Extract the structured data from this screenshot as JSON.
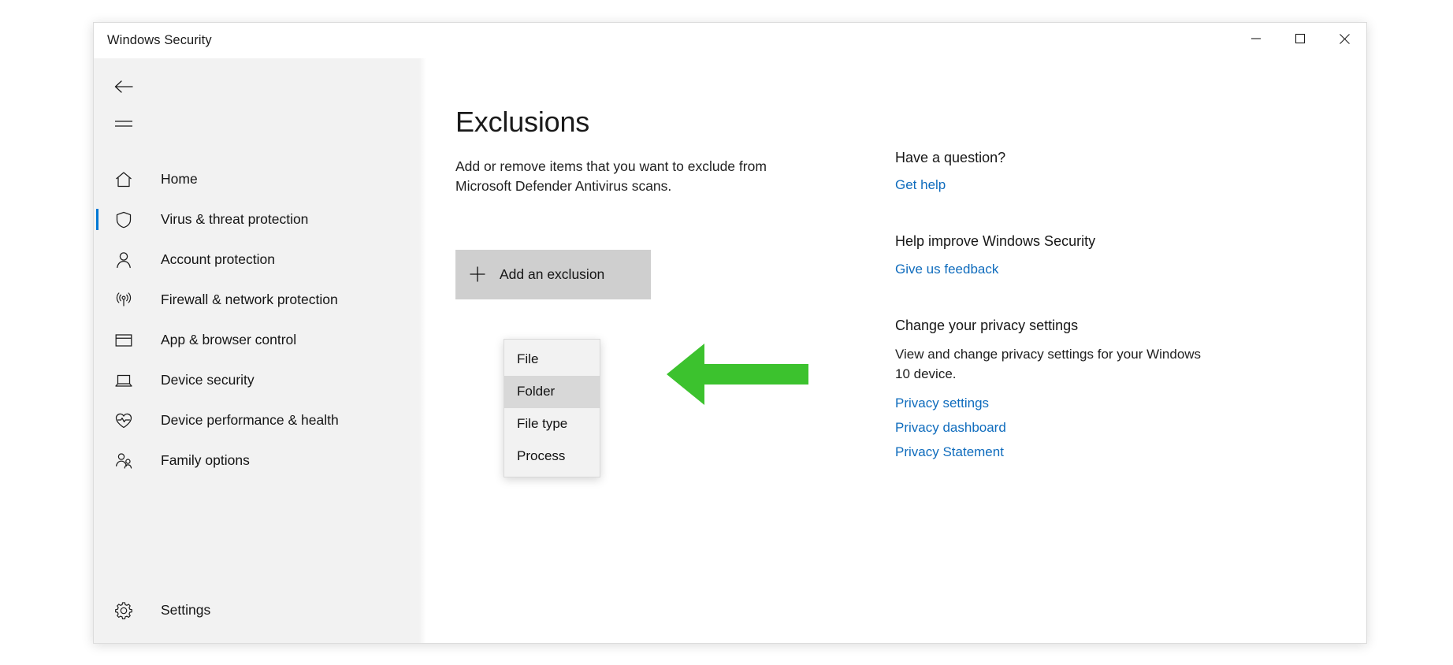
{
  "window": {
    "title": "Windows Security",
    "controls": {
      "minimize": "minimize-icon",
      "maximize": "maximize-icon",
      "close": "close-icon"
    }
  },
  "sidebar": {
    "back_icon": "back-arrow-icon",
    "hamburger_icon": "hamburger-menu-icon",
    "items": [
      {
        "label": "Home",
        "icon": "home-icon",
        "selected": false
      },
      {
        "label": "Virus & threat protection",
        "icon": "shield-icon",
        "selected": true
      },
      {
        "label": "Account protection",
        "icon": "person-icon",
        "selected": false
      },
      {
        "label": "Firewall & network protection",
        "icon": "wifi-signal-icon",
        "selected": false
      },
      {
        "label": "App & browser control",
        "icon": "window-icon",
        "selected": false
      },
      {
        "label": "Device security",
        "icon": "laptop-icon",
        "selected": false
      },
      {
        "label": "Device performance & health",
        "icon": "heartbeat-icon",
        "selected": false
      },
      {
        "label": "Family options",
        "icon": "people-icon",
        "selected": false
      }
    ],
    "settings": {
      "label": "Settings",
      "icon": "gear-icon"
    }
  },
  "main": {
    "title": "Exclusions",
    "description": "Add or remove items that you want to exclude from Microsoft Defender Antivirus scans.",
    "add_button": {
      "label": "Add an exclusion",
      "icon": "plus-icon"
    },
    "dropdown": {
      "options": [
        {
          "label": "File",
          "highlighted": false
        },
        {
          "label": "Folder",
          "highlighted": true
        },
        {
          "label": "File type",
          "highlighted": false
        },
        {
          "label": "Process",
          "highlighted": false
        }
      ]
    },
    "annotation": {
      "icon": "left-arrow-annotation",
      "color": "#3cc22e"
    }
  },
  "help": {
    "groups": [
      {
        "heading": "Have a question?",
        "body": "",
        "links": [
          "Get help"
        ]
      },
      {
        "heading": "Help improve Windows Security",
        "body": "",
        "links": [
          "Give us feedback"
        ]
      },
      {
        "heading": "Change your privacy settings",
        "body": "View and change privacy settings for your Windows 10 device.",
        "links": [
          "Privacy settings",
          "Privacy dashboard",
          "Privacy Statement"
        ]
      }
    ]
  },
  "colors": {
    "accent": "#0078d4",
    "link": "#0f6cbd",
    "annotation_green": "#3cc22e",
    "sidebar_bg": "#f2f2f2",
    "button_bg": "#cfcfcf"
  }
}
